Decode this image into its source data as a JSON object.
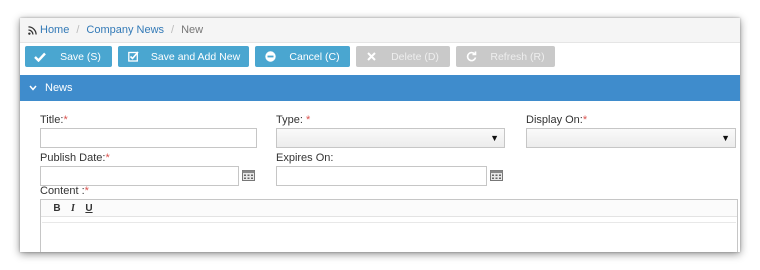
{
  "breadcrumb": {
    "home": "Home",
    "section": "Company News",
    "current": "New"
  },
  "toolbar": {
    "save": "Save (S)",
    "save_add_new": "Save and Add New",
    "cancel": "Cancel (C)",
    "delete": "Delete (D)",
    "refresh": "Refresh (R)"
  },
  "section": {
    "title": "News"
  },
  "form": {
    "title_label": "Title:",
    "type_label": "Type:",
    "display_on_label": "Display On:",
    "publish_date_label": "Publish Date:",
    "expires_on_label": "Expires On:",
    "content_label": "Content :",
    "required_mark": "*",
    "type_value": "",
    "display_on_value": ""
  },
  "editor": {
    "bold": "B",
    "italic": "I",
    "underline": "U"
  },
  "colors": {
    "primary_button": "#4aa6d0",
    "disabled_button": "#c9c9c9",
    "section_header": "#3f8ccc",
    "link": "#337ab7",
    "required": "#d9534f"
  }
}
